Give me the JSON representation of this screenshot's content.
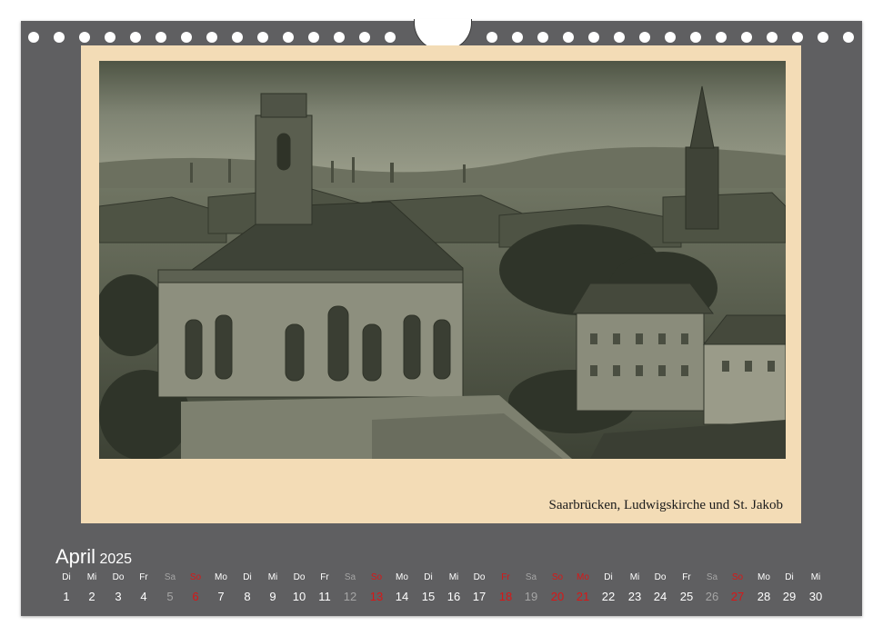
{
  "colors": {
    "page_background": "#5f5f61",
    "photo_mat": "#f3dcb6",
    "weekday_text": "#ffffff",
    "saturday_text": "#a5a5a5",
    "sunday_holiday_text": "#d91616"
  },
  "photo": {
    "caption": "Saarbrücken, Ludwigskirche und St. Jakob"
  },
  "calendar": {
    "month": "April",
    "year": "2025",
    "days": [
      {
        "dow": "Di",
        "day": "1",
        "kind": "weekday"
      },
      {
        "dow": "Mi",
        "day": "2",
        "kind": "weekday"
      },
      {
        "dow": "Do",
        "day": "3",
        "kind": "weekday"
      },
      {
        "dow": "Fr",
        "day": "4",
        "kind": "weekday"
      },
      {
        "dow": "Sa",
        "day": "5",
        "kind": "saturday"
      },
      {
        "dow": "So",
        "day": "6",
        "kind": "sunday"
      },
      {
        "dow": "Mo",
        "day": "7",
        "kind": "weekday"
      },
      {
        "dow": "Di",
        "day": "8",
        "kind": "weekday"
      },
      {
        "dow": "Mi",
        "day": "9",
        "kind": "weekday"
      },
      {
        "dow": "Do",
        "day": "10",
        "kind": "weekday"
      },
      {
        "dow": "Fr",
        "day": "11",
        "kind": "weekday"
      },
      {
        "dow": "Sa",
        "day": "12",
        "kind": "saturday"
      },
      {
        "dow": "So",
        "day": "13",
        "kind": "sunday"
      },
      {
        "dow": "Mo",
        "day": "14",
        "kind": "weekday"
      },
      {
        "dow": "Di",
        "day": "15",
        "kind": "weekday"
      },
      {
        "dow": "Mi",
        "day": "16",
        "kind": "weekday"
      },
      {
        "dow": "Do",
        "day": "17",
        "kind": "weekday"
      },
      {
        "dow": "Fr",
        "day": "18",
        "kind": "sunday"
      },
      {
        "dow": "Sa",
        "day": "19",
        "kind": "saturday"
      },
      {
        "dow": "So",
        "day": "20",
        "kind": "sunday"
      },
      {
        "dow": "Mo",
        "day": "21",
        "kind": "sunday"
      },
      {
        "dow": "Di",
        "day": "22",
        "kind": "weekday"
      },
      {
        "dow": "Mi",
        "day": "23",
        "kind": "weekday"
      },
      {
        "dow": "Do",
        "day": "24",
        "kind": "weekday"
      },
      {
        "dow": "Fr",
        "day": "25",
        "kind": "weekday"
      },
      {
        "dow": "Sa",
        "day": "26",
        "kind": "saturday"
      },
      {
        "dow": "So",
        "day": "27",
        "kind": "sunday"
      },
      {
        "dow": "Mo",
        "day": "28",
        "kind": "weekday"
      },
      {
        "dow": "Di",
        "day": "29",
        "kind": "weekday"
      },
      {
        "dow": "Mi",
        "day": "30",
        "kind": "weekday"
      }
    ]
  }
}
